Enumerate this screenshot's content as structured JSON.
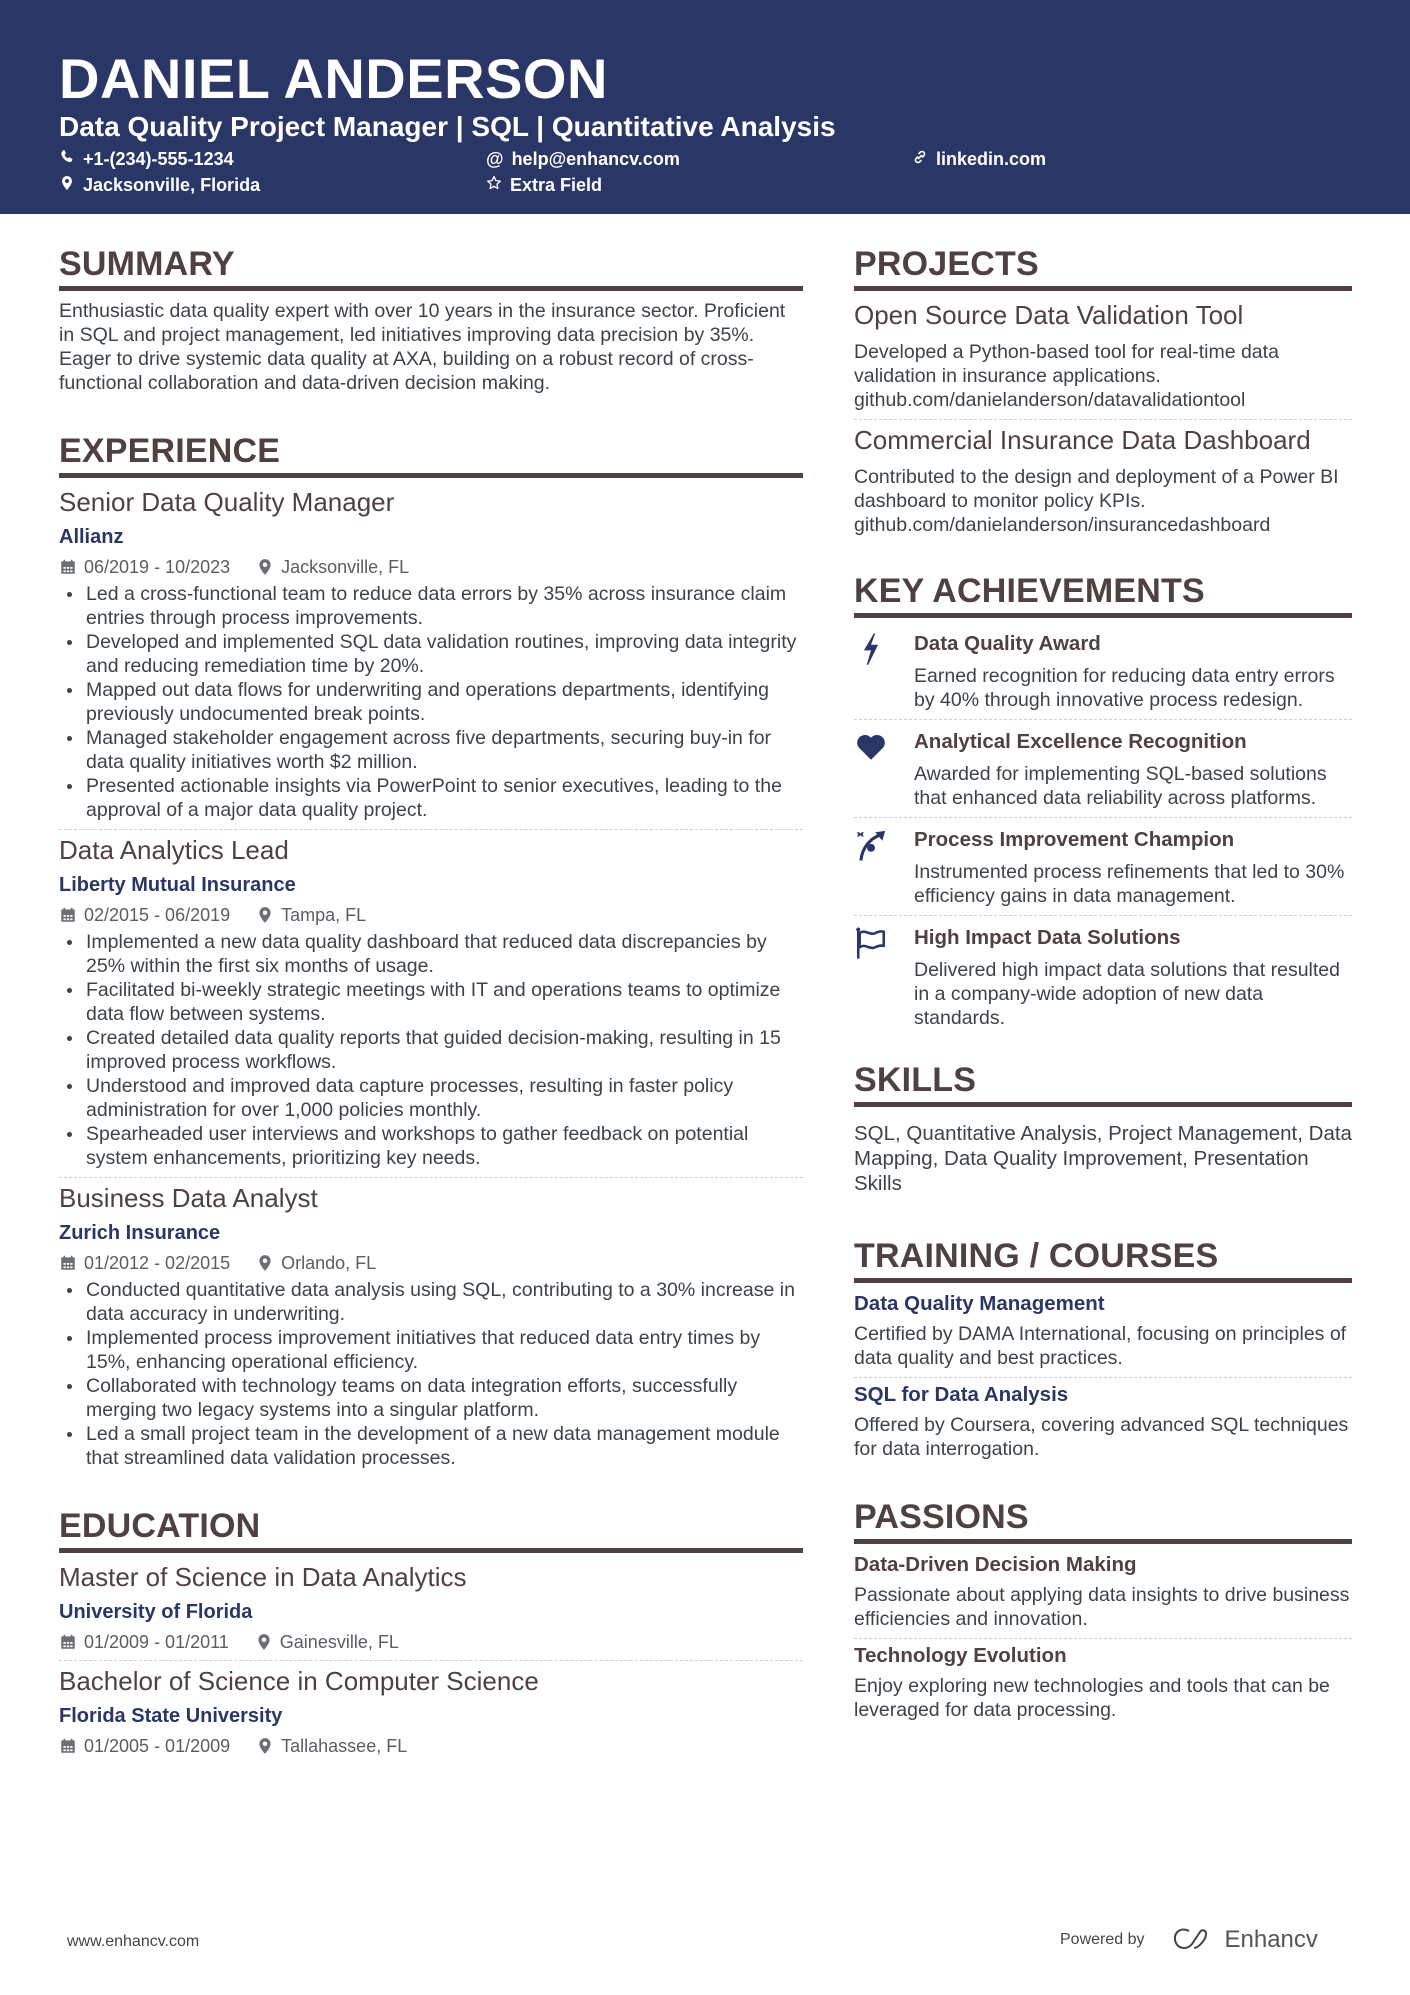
{
  "header": {
    "name": "DANIEL ANDERSON",
    "headline": "Data Quality Project Manager | SQL | Quantitative Analysis",
    "contacts": [
      {
        "icon": "phone-icon",
        "text": "+1-(234)-555-1234"
      },
      {
        "icon": "at-icon",
        "text": "help@enhancv.com"
      },
      {
        "icon": "link-icon",
        "text": "linkedin.com"
      },
      {
        "icon": "location-icon",
        "text": "Jacksonville, Florida"
      },
      {
        "icon": "star-icon",
        "text": "Extra Field"
      }
    ]
  },
  "colors": {
    "header_bg": "#2a3766",
    "heading": "#4f4141",
    "accent": "#2a3766"
  },
  "summary": {
    "title": "SUMMARY",
    "text": "Enthusiastic data quality expert with over 10 years in the insurance sector. Proficient in SQL and project management, led initiatives improving data precision by 35%. Eager to drive systemic data quality at AXA, building on a robust record of cross-functional collaboration and data-driven decision making."
  },
  "experience": {
    "title": "EXPERIENCE",
    "jobs": [
      {
        "title": "Senior Data Quality Manager",
        "company": "Allianz",
        "dates": "06/2019 - 10/2023",
        "location": "Jacksonville, FL",
        "bullets": [
          "Led a cross-functional team to reduce data errors by 35% across insurance claim entries through process improvements.",
          "Developed and implemented SQL data validation routines, improving data integrity and reducing remediation time by 20%.",
          "Mapped out data flows for underwriting and operations departments, identifying previously undocumented break points.",
          "Managed stakeholder engagement across five departments, securing buy-in for data quality initiatives worth $2 million.",
          "Presented actionable insights via PowerPoint to senior executives, leading to the approval of a major data quality project."
        ]
      },
      {
        "title": "Data Analytics Lead",
        "company": "Liberty Mutual Insurance",
        "dates": "02/2015 - 06/2019",
        "location": "Tampa, FL",
        "bullets": [
          "Implemented a new data quality dashboard that reduced data discrepancies by 25% within the first six months of usage.",
          "Facilitated bi-weekly strategic meetings with IT and operations teams to optimize data flow between systems.",
          "Created detailed data quality reports that guided decision-making, resulting in 15 improved process workflows.",
          "Understood and improved data capture processes, resulting in faster policy administration for over 1,000 policies monthly.",
          "Spearheaded user interviews and workshops to gather feedback on potential system enhancements, prioritizing key needs."
        ]
      },
      {
        "title": "Business Data Analyst",
        "company": "Zurich Insurance",
        "dates": "01/2012 - 02/2015",
        "location": "Orlando, FL",
        "bullets": [
          "Conducted quantitative data analysis using SQL, contributing to a 30% increase in data accuracy in underwriting.",
          "Implemented process improvement initiatives that reduced data entry times by 15%, enhancing operational efficiency.",
          "Collaborated with technology teams on data integration efforts, successfully merging two legacy systems into a singular platform.",
          "Led a small project team in the development of a new data management module that streamlined data validation processes."
        ]
      }
    ]
  },
  "education": {
    "title": "EDUCATION",
    "items": [
      {
        "degree": "Master of Science in Data Analytics",
        "school": "University of Florida",
        "dates": "01/2009 - 01/2011",
        "location": "Gainesville, FL"
      },
      {
        "degree": "Bachelor of Science in Computer Science",
        "school": "Florida State University",
        "dates": "01/2005 - 01/2009",
        "location": "Tallahassee, FL"
      }
    ]
  },
  "projects": {
    "title": "PROJECTS",
    "items": [
      {
        "title": "Open Source Data Validation Tool",
        "desc": "Developed a Python-based tool for real-time data validation in insurance applications.",
        "link": "github.com/danielanderson/datavalidationtool"
      },
      {
        "title": "Commercial Insurance Data Dashboard",
        "desc": "Contributed to the design and deployment of a Power BI dashboard to monitor policy KPIs.",
        "link": "github.com/danielanderson/insurancedashboard"
      }
    ]
  },
  "achievements": {
    "title": "KEY ACHIEVEMENTS",
    "items": [
      {
        "icon": "lightning-icon",
        "title": "Data Quality Award",
        "desc": "Earned recognition for reducing data entry errors by 40% through innovative process redesign."
      },
      {
        "icon": "heart-icon",
        "title": "Analytical Excellence Recognition",
        "desc": "Awarded for implementing SQL-based solutions that enhanced data reliability across platforms."
      },
      {
        "icon": "strategy-icon",
        "title": "Process Improvement Champion",
        "desc": "Instrumented process refinements that led to 30% efficiency gains in data management."
      },
      {
        "icon": "flag-icon",
        "title": "High Impact Data Solutions",
        "desc": "Delivered high impact data solutions that resulted in a company-wide adoption of new data standards."
      }
    ]
  },
  "skills": {
    "title": "SKILLS",
    "text": "SQL, Quantitative Analysis, Project Management, Data Mapping, Data Quality Improvement, Presentation Skills"
  },
  "training": {
    "title": "TRAINING / COURSES",
    "items": [
      {
        "title": "Data Quality Management",
        "desc": "Certified by DAMA International, focusing on principles of data quality and best practices."
      },
      {
        "title": "SQL for Data Analysis",
        "desc": "Offered by Coursera, covering advanced SQL techniques for data interrogation."
      }
    ]
  },
  "passions": {
    "title": "PASSIONS",
    "items": [
      {
        "title": "Data-Driven Decision Making",
        "desc": "Passionate about applying data insights to drive business efficiencies and innovation."
      },
      {
        "title": "Technology Evolution",
        "desc": "Enjoy exploring new technologies and tools that can be leveraged for data processing."
      }
    ]
  },
  "footer": {
    "website": "www.enhancv.com",
    "powered_by": "Powered by",
    "brand": "Enhancv"
  }
}
